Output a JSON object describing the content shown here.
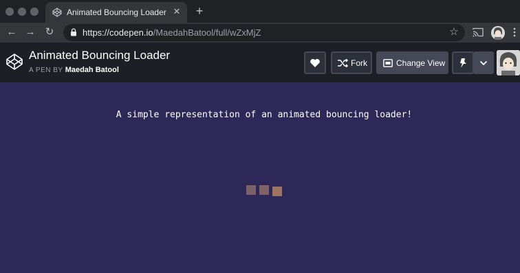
{
  "browser": {
    "tab": {
      "title": "Animated Bouncing Loader",
      "close_glyph": "✕"
    },
    "new_tab_glyph": "+",
    "nav": {
      "back": "←",
      "forward": "→",
      "reload": "↻"
    },
    "url": {
      "scheme": "https://",
      "host": "codepen.io",
      "path": "/MaedahBatool/full/wZxMjZ"
    },
    "star_glyph": "☆",
    "icons": [
      "codepen-favicon-icon",
      "lock-icon",
      "star-icon",
      "cast-icon",
      "profile-icon",
      "menu-dots-icon"
    ]
  },
  "codepen": {
    "title": "Animated Bouncing Loader",
    "byline_prefix": "A PEN BY",
    "author": "Maedah Batool",
    "buttons": {
      "fork": "Fork",
      "change_view": "Change View"
    },
    "icons": [
      "codepen-logo-icon",
      "heart-icon",
      "fork-icon",
      "change-view-icon",
      "pin-icon",
      "chevron-down-icon",
      "avatar"
    ]
  },
  "pen": {
    "text": "A simple representation of an animated bouncing loader!",
    "loader_colors": [
      "#7a6068",
      "#806268",
      "#9e7562"
    ]
  },
  "colors": {
    "chrome_dark": "#202124",
    "chrome_toolbar": "#35363a",
    "codepen_header": "#1e1f26",
    "pen_background": "#2d2858"
  }
}
